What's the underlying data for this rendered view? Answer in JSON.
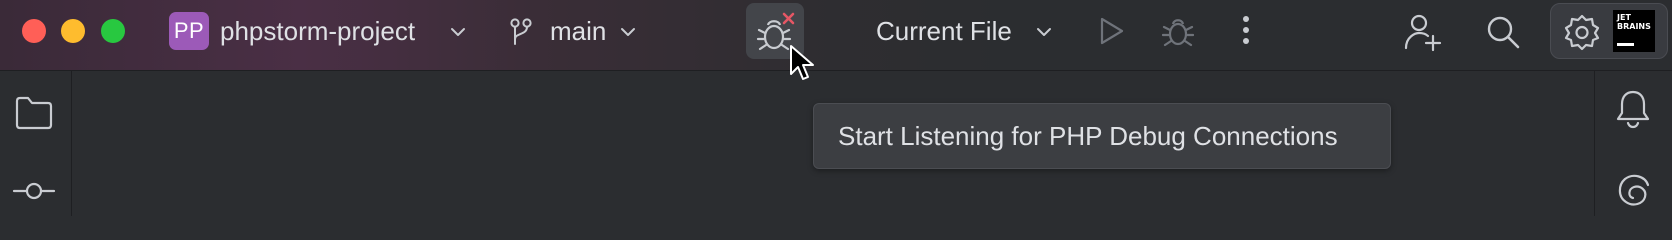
{
  "titlebar": {
    "project": {
      "avatar_initials": "PP",
      "avatar_color": "#9c5ab8",
      "name": "phpstorm-project"
    },
    "branch": {
      "name": "main"
    },
    "run_configuration": {
      "label": "Current File"
    }
  },
  "tooltip": {
    "text": "Start Listening for PHP Debug Connections"
  },
  "jetbrains_logo": {
    "line1": "JET",
    "line2": "BRAINS"
  },
  "colors": {
    "accent_avatar": "#9c5ab8",
    "close_red": "#ff5f57",
    "minimize_yellow": "#febc2e",
    "zoom_green": "#28c840",
    "debug_disabled_mark": "#e55765"
  },
  "icons": {
    "left_stripe": [
      "folder-icon",
      "commit-icon"
    ],
    "right_stripe": [
      "bell-icon",
      "ai-assistant-icon"
    ],
    "toolbar": [
      "branch-icon",
      "debug-listen-icon",
      "run-icon",
      "debug-icon",
      "more-vertical-icon",
      "add-user-icon",
      "search-icon",
      "gear-icon"
    ]
  }
}
